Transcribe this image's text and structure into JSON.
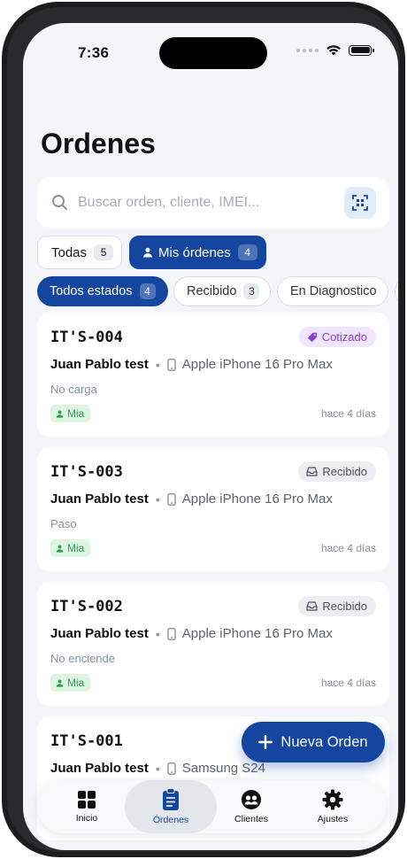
{
  "status_bar": {
    "time": "7:36"
  },
  "page": {
    "title": "Ordenes"
  },
  "search": {
    "placeholder": "Buscar orden, cliente, IMEI..."
  },
  "segments": [
    {
      "label": "Todas",
      "count": "5",
      "active": false
    },
    {
      "label": "Mis órdenes",
      "count": "4",
      "active": true
    }
  ],
  "filters": [
    {
      "label": "Todos estados",
      "count": "4",
      "active": true
    },
    {
      "label": "Recibido",
      "count": "3",
      "active": false
    },
    {
      "label": "En Diagnostico",
      "count": "",
      "active": false
    }
  ],
  "orders": [
    {
      "code": "IT'S-004",
      "status": "Cotizado",
      "client": "Juan Pablo test",
      "device": "Apple iPhone 16 Pro Max",
      "note": "No carga",
      "assignee": "Mia",
      "time": "hace 4 días"
    },
    {
      "code": "IT'S-003",
      "status": "Recibido",
      "client": "Juan Pablo test",
      "device": "Apple iPhone 16 Pro Max",
      "note": "Paso",
      "assignee": "Mia",
      "time": "hace 4 días"
    },
    {
      "code": "IT'S-002",
      "status": "Recibido",
      "client": "Juan Pablo test",
      "device": "Apple iPhone 16 Pro Max",
      "note": "No enciende",
      "assignee": "Mia",
      "time": "hace 4 días"
    },
    {
      "code": "IT'S-001",
      "status": "",
      "client": "Juan Pablo test",
      "device": "Samsung S24",
      "note": "",
      "assignee": "",
      "time": ""
    }
  ],
  "fab": {
    "label": "Nueva Orden"
  },
  "tabbar": [
    {
      "label": "Inicio",
      "icon": "grid-icon",
      "active": false
    },
    {
      "label": "Órdenes",
      "icon": "clipboard-icon",
      "active": true
    },
    {
      "label": "Clientes",
      "icon": "people-icon",
      "active": false
    },
    {
      "label": "Ajustes",
      "icon": "gear-icon",
      "active": false
    }
  ],
  "colors": {
    "accent": "#1446a0",
    "background": "#f3f5f9",
    "cotizado": "#8a3fd0",
    "assignee": "#2f9a55"
  }
}
